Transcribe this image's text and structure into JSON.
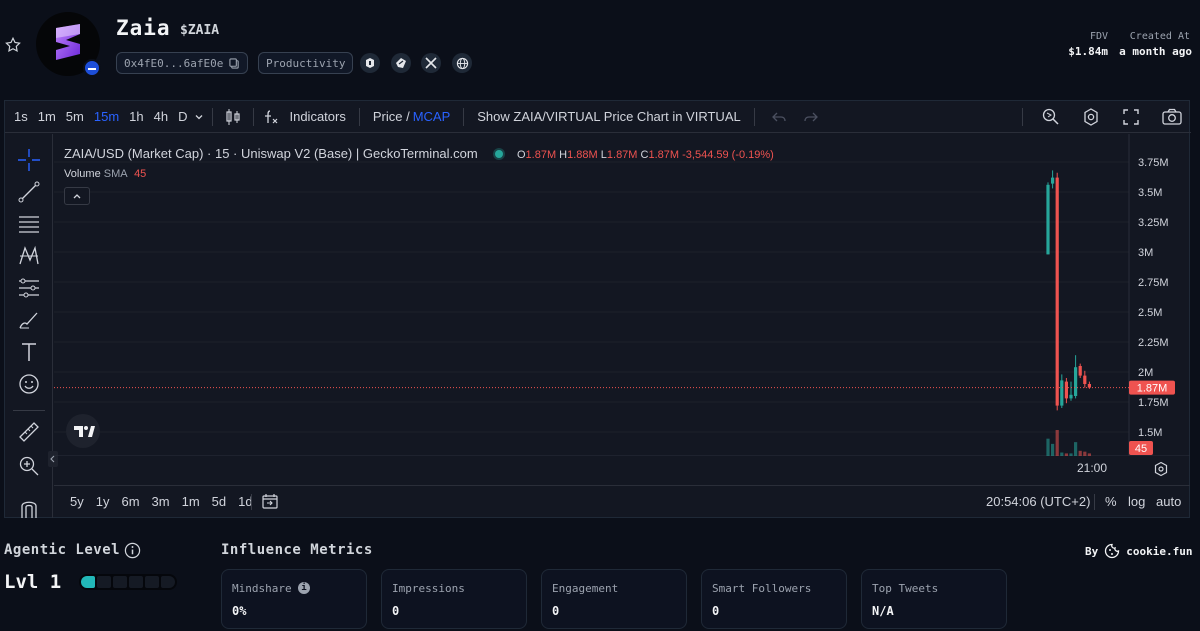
{
  "token": {
    "name": "Zaia",
    "ticker": "$ZAIA",
    "address": "0x4fE0...6afE0e",
    "category": "Productivity",
    "fdv_label": "FDV",
    "fdv_value": "$1.84m",
    "created_label": "Created At",
    "created_value": "a month ago"
  },
  "toolbar": {
    "intervals": [
      "1s",
      "1m",
      "5m",
      "15m",
      "1h",
      "4h",
      "D"
    ],
    "active_interval": "15m",
    "indicators_label": "Indicators",
    "price_label": "Price /",
    "mcap_label": "MCAP",
    "show_label": "Show ZAIA/VIRTUAL Price Chart in VIRTUAL"
  },
  "legend": {
    "symbol": "ZAIA/USD (Market Cap) · 15 · Uniswap V2 (Base) | GeckoTerminal.com",
    "o_label": "O",
    "o_val": "1.87M",
    "h_label": "H",
    "h_val": "1.88M",
    "l_label": "L",
    "l_val": "1.87M",
    "c_label": "C",
    "c_val": "1.87M",
    "change": "-3,544.59 (-0.19%)",
    "volume_label": "Volume",
    "sma_label": "SMA",
    "sma_val": "45"
  },
  "chart_data": {
    "type": "candlestick",
    "y_ticks": [
      "3.75M",
      "3.5M",
      "3.25M",
      "3M",
      "2.75M",
      "2.5M",
      "2.25M",
      "2M",
      "1.75M",
      "1.5M"
    ],
    "y_tick_values": [
      3.75,
      3.5,
      3.25,
      3.0,
      2.75,
      2.5,
      2.25,
      2.0,
      1.75,
      1.5
    ],
    "ylim": [
      1.41,
      3.85
    ],
    "current_price_label": "1.87M",
    "current_price": 1.87,
    "volume_label_box": "45",
    "x_tick": "21:00",
    "candles": [
      {
        "o": 2.98,
        "h": 3.58,
        "l": 2.98,
        "c": 3.56
      },
      {
        "o": 3.57,
        "h": 3.68,
        "l": 3.53,
        "c": 3.62
      },
      {
        "o": 3.62,
        "h": 3.66,
        "l": 1.68,
        "c": 1.72
      },
      {
        "o": 1.72,
        "h": 1.98,
        "l": 1.7,
        "c": 1.93
      },
      {
        "o": 1.92,
        "h": 1.95,
        "l": 1.74,
        "c": 1.78
      },
      {
        "o": 1.78,
        "h": 1.92,
        "l": 1.76,
        "c": 1.81
      },
      {
        "o": 1.8,
        "h": 2.14,
        "l": 1.78,
        "c": 2.04
      },
      {
        "o": 2.05,
        "h": 2.07,
        "l": 1.95,
        "c": 1.97
      },
      {
        "o": 1.97,
        "h": 2.01,
        "l": 1.87,
        "c": 1.9
      },
      {
        "o": 1.9,
        "h": 1.92,
        "l": 1.86,
        "c": 1.87
      }
    ],
    "volumes": [
      20,
      14,
      30,
      4,
      3,
      3,
      16,
      6,
      5,
      3
    ]
  },
  "bottombar": {
    "ranges": [
      "5y",
      "1y",
      "6m",
      "3m",
      "1m",
      "5d",
      "1d"
    ],
    "time": "20:54:06 (UTC+2)",
    "pct": "%",
    "log": "log",
    "auto": "auto"
  },
  "agentic": {
    "title": "Agentic Level",
    "level": "Lvl 1",
    "filled": 1,
    "total": 6,
    "fill_color": "#22b8b8"
  },
  "influence": {
    "title": "Influence Metrics",
    "by_label": "By",
    "brand": "cookie.fun",
    "metrics": [
      {
        "label": "Mindshare",
        "value": "0%"
      },
      {
        "label": "Impressions",
        "value": "0"
      },
      {
        "label": "Engagement",
        "value": "0"
      },
      {
        "label": "Smart Followers",
        "value": "0"
      },
      {
        "label": "Top Tweets",
        "value": "N/A"
      }
    ]
  },
  "colors": {
    "up": "#26a69a",
    "down": "#ef5350",
    "active": "#2962ff"
  }
}
